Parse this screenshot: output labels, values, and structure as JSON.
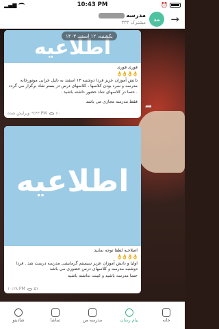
{
  "status_bar": {
    "carrier_icon": "signal-icon",
    "time": "10:43 PM"
  },
  "header": {
    "channel_name": "مدرسه",
    "avatar_text": "مد",
    "subscribers": "۳۳۳ مشترک",
    "back_icon": "arrow-right-icon"
  },
  "date_pill": "یکشنبه، ۱۲ اسفند ۱۴۰۳",
  "messages": [
    {
      "image_word": "اطلاعیه",
      "title": "فوری فوری",
      "emoji": "👌👌👌👌",
      "body": "دانش آموزان عزیز فردا دوشنبه ۱۳ اسفند به دلیل خرابی موتورخانه مدرسه و سرد بودن کلاسها ، کلاسهای درس در بستر شاد برگزار می گردد . حتما در کلاسهای شاد حضور داشته باشید .",
      "footer": "فقط مدرسه مجازی می باشد",
      "views": "۶۰",
      "time": "۹:۴۳ PM",
      "edited": "ویرایش شده"
    },
    {
      "image_word": "اطلاعیه",
      "title": "اصلاحیه لطفا توجه نمایید",
      "emoji": "👌👌👌👌",
      "body": "اولیا و دانش آموزان عزیز سیستم گرمایشی مدرسه درست شد . فردا دوشنبه مدرسه و کلاسهای درس حضوری می باشد",
      "footer": "حتما مدرسه باشید و غیبت نداشته باشید",
      "views": "۵۱",
      "time": "۱۰:۲۸ PM"
    }
  ],
  "bottom_nav": [
    {
      "label": "خانه",
      "icon": "home-icon",
      "active": false
    },
    {
      "label": "پیام رسان",
      "icon": "chat-icon",
      "active": true
    },
    {
      "label": "مدرسه من",
      "icon": "school-icon",
      "active": false
    },
    {
      "label": "تماشا",
      "icon": "play-icon",
      "active": false
    },
    {
      "label": "شادینو",
      "icon": "shadino-icon",
      "active": false
    }
  ],
  "colors": {
    "accent": "#3fae8c",
    "image_blue": "#9ccbe5"
  }
}
